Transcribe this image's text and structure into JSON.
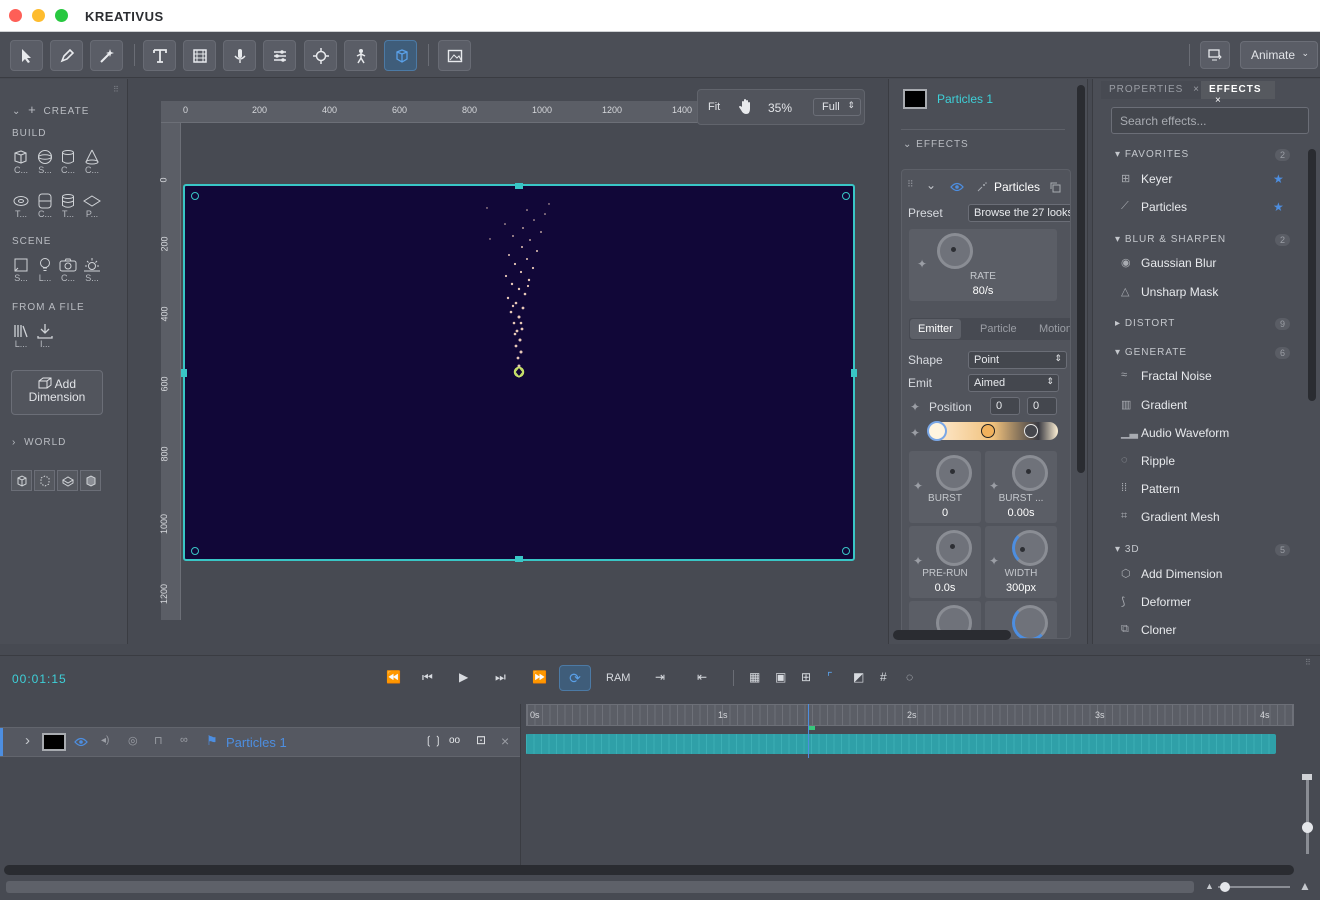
{
  "app": {
    "title": "KREATIVUS",
    "animate_label": "Animate"
  },
  "colors": {
    "accent": "#3ed0d8",
    "blue": "#4d8ee0",
    "canvas_bg": "#110738",
    "selection": "#39c6c6"
  },
  "toolbar": {
    "tools": [
      "select-icon",
      "pen-icon",
      "wand-icon",
      "text-icon",
      "film-icon",
      "mic-icon",
      "sliders-icon",
      "crosshair-icon",
      "figure-icon",
      "cube-icon",
      "image-icon"
    ]
  },
  "left": {
    "create": "CREATE",
    "build": "BUILD",
    "build_items": [
      "C...",
      "S...",
      "C...",
      "C...",
      "T...",
      "C...",
      "T...",
      "P..."
    ],
    "scene": "SCENE",
    "scene_items": [
      "S...",
      "L...",
      "C...",
      "S..."
    ],
    "from_file": "FROM A FILE",
    "file_items": [
      "L...",
      "I..."
    ],
    "add_dimension_1": "Add",
    "add_dimension_2": "Dimension",
    "world": "WORLD"
  },
  "viewport": {
    "fit": "Fit",
    "zoom": "35%",
    "quality": "Full",
    "ruler_x": [
      "0",
      "200",
      "400",
      "600",
      "800",
      "1000",
      "1200",
      "1400"
    ],
    "ruler_y": [
      "0",
      "200",
      "400",
      "600",
      "800",
      "1000",
      "1200"
    ]
  },
  "effect_controls": {
    "layer_name": "Particles 1",
    "effects_header": "EFFECTS",
    "effect_name": "Particles",
    "preset_label": "Preset",
    "preset_value": "Browse the 27 looks",
    "rate_label": "RATE",
    "rate_value": "80/s",
    "tabs": [
      "Emitter",
      "Particle",
      "Motion"
    ],
    "shape_label": "Shape",
    "shape_value": "Point",
    "emit_label": "Emit",
    "emit_value": "Aimed",
    "position_label": "Position",
    "position_x": "0",
    "position_y": "0",
    "burst_label": "BURST",
    "burst_value": "0",
    "burst2_label": "BURST ...",
    "burst2_value": "0.00s",
    "prerun_label": "PRE-RUN",
    "prerun_value": "0.0s",
    "width_label": "WIDTH",
    "width_value": "300px"
  },
  "effects_panel": {
    "tab_properties": "PROPERTIES",
    "tab_effects": "EFFECTS",
    "search_placeholder": "Search effects...",
    "groups": [
      {
        "name": "FAVORITES",
        "count": "2",
        "items": [
          "Keyer",
          "Particles"
        ]
      },
      {
        "name": "BLUR & SHARPEN",
        "count": "2",
        "items": [
          "Gaussian Blur",
          "Unsharp Mask"
        ]
      },
      {
        "name": "DISTORT",
        "count": "9",
        "items": []
      },
      {
        "name": "GENERATE",
        "count": "6",
        "items": [
          "Fractal Noise",
          "Gradient",
          "Audio Waveform",
          "Ripple",
          "Pattern",
          "Gradient Mesh"
        ]
      },
      {
        "name": "3D",
        "count": "5",
        "items": [
          "Add Dimension",
          "Deformer",
          "Cloner"
        ]
      }
    ]
  },
  "timeline": {
    "timecode": "00:01:15",
    "ram": "RAM",
    "layer_name": "Particles 1",
    "ticks": [
      "0s",
      "1s",
      "2s",
      "3s",
      "4s"
    ]
  }
}
